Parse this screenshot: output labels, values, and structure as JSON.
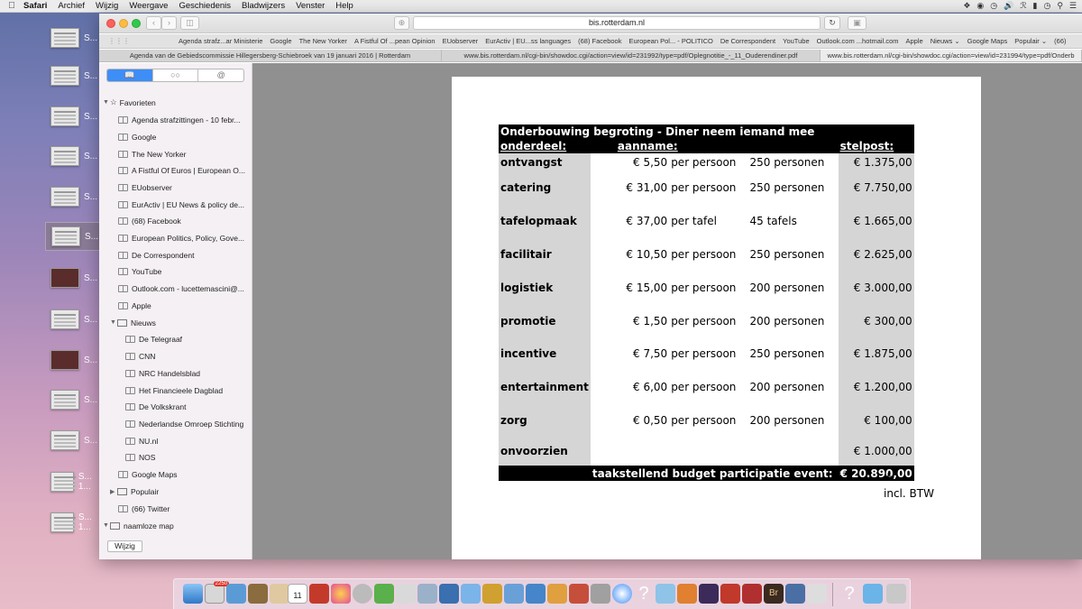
{
  "menubar": {
    "items": [
      "Safari",
      "Archief",
      "Wijzig",
      "Weergave",
      "Geschiedenis",
      "Bladwijzers",
      "Venster",
      "Help"
    ]
  },
  "thumbnails": [
    "S...",
    "S...",
    "S...",
    "S...",
    "S...",
    "S...",
    "S...",
    "S...",
    "S...",
    "S...",
    "S...",
    "S... 1...",
    "S... 1..."
  ],
  "browser": {
    "address": "bis.rotterdam.nl",
    "favorites_bar": [
      "Agenda strafz...ar Ministerie",
      "Google",
      "The New Yorker",
      "A Fistful Of ...pean Opinion",
      "EUobserver",
      "EurActiv | EU...ss languages",
      "(68) Facebook",
      "European Pol... - POLITICO",
      "De Correspondent",
      "YouTube",
      "Outlook.com ...hotmail.com",
      "Apple",
      "Nieuws ⌄",
      "Google Maps",
      "Populair ⌄",
      "(66)"
    ],
    "tabs": [
      "Agenda van de Gebiedscommissie Hillegersberg-Schiebroek van 19 januari 2016 | Rotterdam",
      "www.bis.rotterdam.nl/cgi-bin/showdoc.cgi/action=view/id=231992/type=pdf/Oplegnotitie_-_11_Ouderendiner.pdf",
      "www.bis.rotterdam.nl/cgi-bin/showdoc.cgi/action=view/id=231994/type=pdf/Onderb"
    ]
  },
  "sidebar": {
    "segments": [
      "📖",
      "○○",
      "@"
    ],
    "favorites_label": "Favorieten",
    "bookmarks": [
      "Agenda strafzittingen - 10 febr...",
      "Google",
      "The New Yorker",
      "A Fistful Of Euros | European O...",
      "EUobserver",
      "EurActiv | EU News & policy de...",
      "(68) Facebook",
      "European Politics, Policy, Gove...",
      "De Correspondent",
      "YouTube",
      "Outlook.com - lucettemascini@...",
      "Apple"
    ],
    "nieuws_label": "Nieuws",
    "nieuws": [
      "De Telegraaf",
      "CNN",
      "NRC Handelsblad",
      "Het Financieele Dagblad",
      "De Volkskrant",
      "Nederlandse Omroep Stichting",
      "NU.nl",
      "NOS"
    ],
    "after": [
      "Google Maps"
    ],
    "populair_label": "Populair",
    "twitter_label": "(66) Twitter",
    "folder_label": "naamloze map",
    "edit_button": "Wijzig"
  },
  "document": {
    "title": "Onderbouwing begroting -  Diner neem iemand mee",
    "headers": {
      "onderdeel": "onderdeel:",
      "aanname": "aanname:",
      "stelpost": "stelpost:"
    },
    "rows": [
      {
        "label": "ontvangst",
        "amount": "€ 5,50",
        "unit": "per persoon",
        "count": "250 personen",
        "total": "€ 1.375,00"
      },
      {
        "label": "catering",
        "amount": "€ 31,00",
        "unit": "per persoon",
        "count": "250 personen",
        "total": "€ 7.750,00"
      },
      {
        "label": "tafelopmaak",
        "amount": "€ 37,00",
        "unit": "per tafel",
        "count": "45 tafels",
        "total": "€ 1.665,00"
      },
      {
        "label": "facilitair",
        "amount": "€ 10,50",
        "unit": "per persoon",
        "count": "250 personen",
        "total": "€ 2.625,00"
      },
      {
        "label": "logistiek",
        "amount": "€ 15,00",
        "unit": "per persoon",
        "count": "200 personen",
        "total": "€ 3.000,00"
      },
      {
        "label": "promotie",
        "amount": "€ 1,50",
        "unit": "per persoon",
        "count": "200 personen",
        "total": "€ 300,00"
      },
      {
        "label": "incentive",
        "amount": "€ 7,50",
        "unit": "per persoon",
        "count": "250 personen",
        "total": "€ 1.875,00"
      },
      {
        "label": "entertainment",
        "amount": "€ 6,00",
        "unit": "per persoon",
        "count": "200 personen",
        "total": "€ 1.200,00"
      },
      {
        "label": "zorg",
        "amount": "€ 0,50",
        "unit": "per persoon",
        "count": "200 personen",
        "total": "€ 100,00"
      }
    ],
    "unforeseen": {
      "label": "onvoorzien",
      "total": "€ 1.000,00"
    },
    "plus": "+",
    "footer_label": "taakstellend budget participatie event:",
    "footer_total": "€ 20.890,00",
    "footer_note": "incl. BTW"
  },
  "dock": {
    "badge": "2250",
    "calendar_day": "11"
  },
  "colors": {
    "accent": "#3d8ef7",
    "table_black": "#000000",
    "table_grey": "#d5d5d5"
  }
}
